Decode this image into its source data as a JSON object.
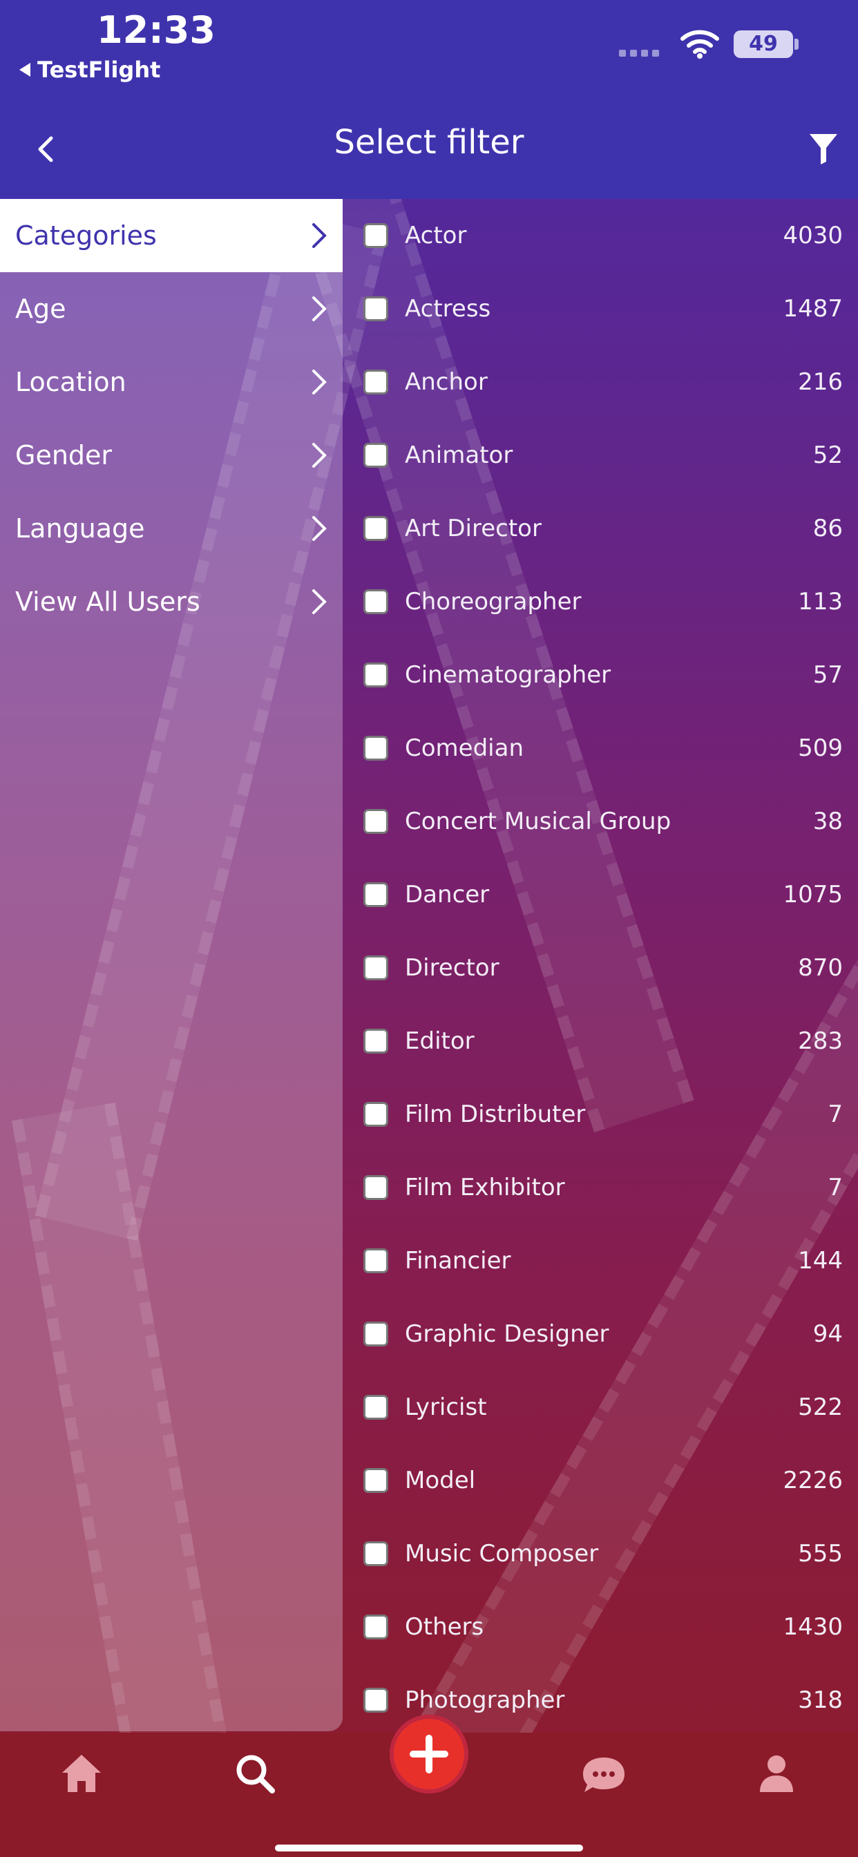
{
  "status": {
    "time": "12:33",
    "back_app": "TestFlight",
    "battery": "49"
  },
  "header": {
    "title": "Select filter",
    "back_icon": "chevron-left-icon",
    "filter_icon": "filter-icon"
  },
  "menu": {
    "items": [
      {
        "label": "Categories",
        "active": true
      },
      {
        "label": "Age"
      },
      {
        "label": "Location"
      },
      {
        "label": "Gender"
      },
      {
        "label": "Language"
      },
      {
        "label": "View All Users"
      }
    ]
  },
  "categories": [
    {
      "name": "Actor",
      "count": "4030"
    },
    {
      "name": "Actress",
      "count": "1487"
    },
    {
      "name": "Anchor",
      "count": "216"
    },
    {
      "name": "Animator",
      "count": "52"
    },
    {
      "name": "Art Director",
      "count": "86"
    },
    {
      "name": "Choreographer",
      "count": "113"
    },
    {
      "name": "Cinematographer",
      "count": "57"
    },
    {
      "name": "Comedian",
      "count": "509"
    },
    {
      "name": "Concert Musical Group",
      "count": "38"
    },
    {
      "name": "Dancer",
      "count": "1075"
    },
    {
      "name": "Director",
      "count": "870"
    },
    {
      "name": "Editor",
      "count": "283"
    },
    {
      "name": "Film Distributer",
      "count": "7"
    },
    {
      "name": "Film Exhibitor",
      "count": "7"
    },
    {
      "name": "Financier",
      "count": "144"
    },
    {
      "name": "Graphic Designer",
      "count": "94"
    },
    {
      "name": "Lyricist",
      "count": "522"
    },
    {
      "name": "Model",
      "count": "2226"
    },
    {
      "name": "Music Composer",
      "count": "555"
    },
    {
      "name": "Others",
      "count": "1430"
    },
    {
      "name": "Photographer",
      "count": "318"
    }
  ],
  "tabbar": {
    "items": [
      "home-icon",
      "search-icon",
      "plus-icon",
      "chat-icon",
      "profile-icon"
    ]
  },
  "colors": {
    "primary": "#3f33ad",
    "tabbar": "#8b1b29",
    "fab": "#e8302b"
  }
}
